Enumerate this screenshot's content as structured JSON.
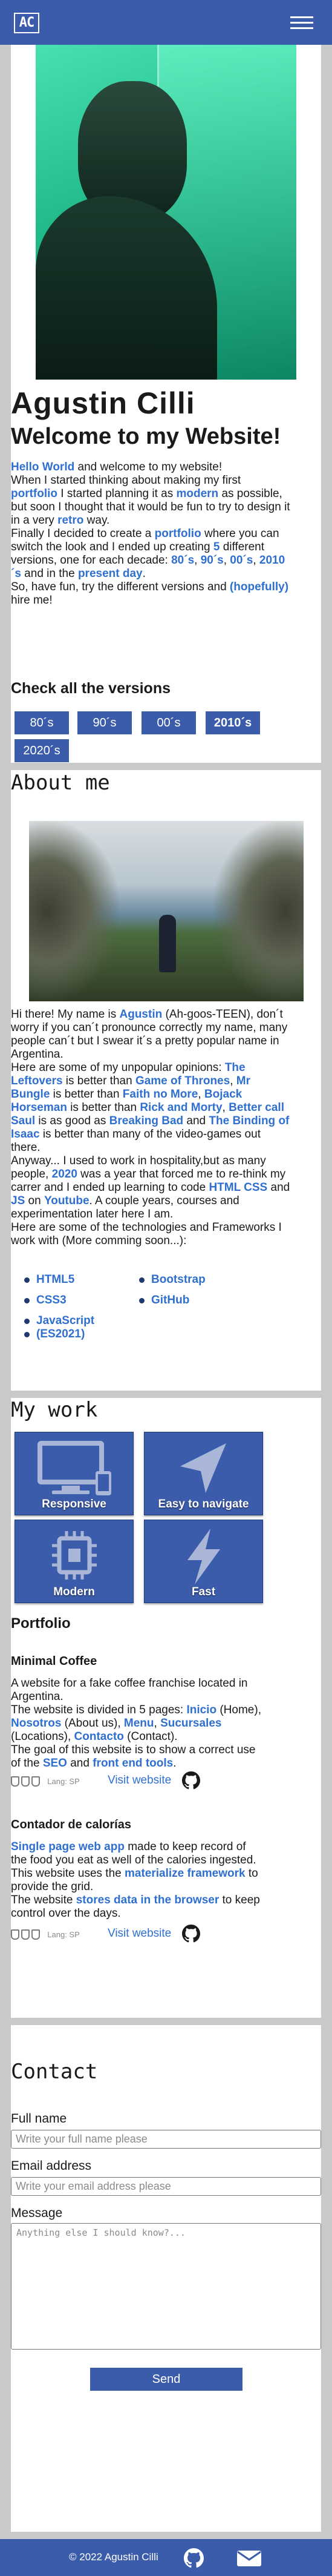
{
  "header": {
    "logo_text": "AC",
    "menu_icon": "hamburger-menu-icon"
  },
  "hero": {
    "name": "Agustin Cilli",
    "welcome": "Welcome to my Website!",
    "intro": [
      [
        {
          "t": "Hello World",
          "h": true
        },
        {
          "t": " and welcome to my website!"
        }
      ],
      [
        {
          "t": "When I started thinking about making my first "
        }
      ],
      [
        {
          "t": "portfolio",
          "h": true
        },
        {
          "t": " I started planning it as "
        },
        {
          "t": "modern",
          "h": true
        },
        {
          "t": " as possible,"
        }
      ],
      [
        {
          "t": "but soon I thought that it would be fun to try to design it"
        }
      ],
      [
        {
          "t": "in a very "
        },
        {
          "t": "retro",
          "h": true
        },
        {
          "t": " way."
        }
      ],
      [
        {
          "t": "Finally I decided to create a "
        },
        {
          "t": "portfolio",
          "h": true
        },
        {
          "t": " where you can"
        }
      ],
      [
        {
          "t": "switch the look and I ended up creating "
        },
        {
          "t": "5",
          "h": true
        },
        {
          "t": " different"
        }
      ],
      [
        {
          "t": "versions, one for each decade: "
        },
        {
          "t": "80´s",
          "h": true
        },
        {
          "t": ", "
        },
        {
          "t": "90´s",
          "h": true
        },
        {
          "t": ", "
        },
        {
          "t": "00´s",
          "h": true
        },
        {
          "t": ", "
        },
        {
          "t": "2010",
          "h": true
        }
      ],
      [
        {
          "t": "´s",
          "h": true
        },
        {
          "t": " and in the "
        },
        {
          "t": "present day",
          "h": true
        },
        {
          "t": "."
        }
      ],
      [
        {
          "t": "So, have fun, try the different versions and "
        },
        {
          "t": "(hopefully)",
          "h": true
        }
      ],
      [
        {
          "t": "hire me!"
        }
      ]
    ],
    "versions_title": "Check all the versions",
    "versions": [
      "80´s",
      "90´s",
      "00´s",
      "2010´s",
      "2020´s"
    ]
  },
  "about": {
    "title": "About me",
    "text": [
      [
        {
          "t": "Hi there! My name is "
        },
        {
          "t": "Agustin",
          "h": true
        },
        {
          "t": " (Ah-goos-TEEN), don´t"
        }
      ],
      [
        {
          "t": "worry if you can´t pronounce correctly my name, many"
        }
      ],
      [
        {
          "t": "people can´t but I swear it´s a pretty popular name in"
        }
      ],
      [
        {
          "t": "Argentina."
        }
      ],
      [
        {
          "t": "Here are some of my unpopular opinions: "
        },
        {
          "t": "The",
          "h": true
        }
      ],
      [
        {
          "t": "Leftovers",
          "h": true
        },
        {
          "t": " is better than "
        },
        {
          "t": "Game of Thrones",
          "h": true
        },
        {
          "t": ", "
        },
        {
          "t": "Mr",
          "h": true
        }
      ],
      [
        {
          "t": "Bungle",
          "h": true
        },
        {
          "t": " is better than "
        },
        {
          "t": "Faith no More",
          "h": true
        },
        {
          "t": ", "
        },
        {
          "t": "Bojack",
          "h": true
        }
      ],
      [
        {
          "t": "Horseman",
          "h": true
        },
        {
          "t": " is better than "
        },
        {
          "t": "Rick and Morty",
          "h": true
        },
        {
          "t": ", "
        },
        {
          "t": "Better call",
          "h": true
        }
      ],
      [
        {
          "t": "Saul",
          "h": true
        },
        {
          "t": " is as good as "
        },
        {
          "t": "Breaking Bad",
          "h": true
        },
        {
          "t": " and "
        },
        {
          "t": "The Binding of",
          "h": true
        }
      ],
      [
        {
          "t": "Isaac",
          "h": true
        },
        {
          "t": " is better than many of the video-games out"
        }
      ],
      [
        {
          "t": "there."
        }
      ],
      [
        {
          "t": "Anyway... I used to work in hospitality,but as many"
        }
      ],
      [
        {
          "t": "people, "
        },
        {
          "t": "2020",
          "h": true
        },
        {
          "t": " was a year that forced me to re-think my"
        }
      ],
      [
        {
          "t": "carrer and I ended up learning to code "
        },
        {
          "t": "HTML CSS",
          "h": true
        },
        {
          "t": " and"
        }
      ],
      [
        {
          "t": "JS",
          "h": true
        },
        {
          "t": " on "
        },
        {
          "t": "Youtube",
          "h": true
        },
        {
          "t": ". A couple years, courses and"
        }
      ],
      [
        {
          "t": "experimentation later here I am."
        }
      ],
      [
        {
          "t": "Here are some of the technologies and Frameworks I"
        }
      ],
      [
        {
          "t": "work with (More comming soon...):"
        }
      ]
    ],
    "tech_left": [
      "HTML5",
      "CSS3",
      "JavaScript",
      "(ES2021)"
    ],
    "tech_right": [
      "Bootstrap",
      "GitHub"
    ]
  },
  "work": {
    "title": "My work",
    "tiles": [
      {
        "label": "Responsive",
        "icon": "devices-icon"
      },
      {
        "label": "Easy to navigate",
        "icon": "navigation-arrow-icon"
      },
      {
        "label": "Modern",
        "icon": "chip-icon"
      },
      {
        "label": "Fast",
        "icon": "lightning-icon"
      }
    ],
    "portfolio_title": "Portfolio",
    "projects": [
      {
        "name": "Minimal Coffee",
        "desc": [
          [
            {
              "t": "A website for a fake coffee franchise located in"
            }
          ],
          [
            {
              "t": "Argentina."
            }
          ],
          [
            {
              "t": "The website is divided in 5 pages: "
            },
            {
              "t": "Inicio",
              "h": true
            },
            {
              "t": " (Home),"
            }
          ],
          [
            {
              "t": "Nosotros",
              "h": true
            },
            {
              "t": " (About us), "
            },
            {
              "t": "Menu",
              "h": true
            },
            {
              "t": ", "
            },
            {
              "t": "Sucursales",
              "h": true
            }
          ],
          [
            {
              "t": "(Locations), "
            },
            {
              "t": "Contacto",
              "h": true
            },
            {
              "t": " (Contact)."
            }
          ],
          [
            {
              "t": "The goal of this website is to show a correct use"
            }
          ],
          [
            {
              "t": "of the "
            },
            {
              "t": "SEO",
              "h": true
            },
            {
              "t": " and "
            },
            {
              "t": "front end tools",
              "h": true
            },
            {
              "t": "."
            }
          ]
        ],
        "lang": "Lang: SP",
        "visit": "Visit website"
      },
      {
        "name": "Contador de calorías",
        "desc": [
          [
            {
              "t": "Single page web app",
              "h": true
            },
            {
              "t": " made to keep record of"
            }
          ],
          [
            {
              "t": "the food you eat as well of the calories ingested."
            }
          ],
          [
            {
              "t": "This website uses the "
            },
            {
              "t": "materialize framework",
              "h": true
            },
            {
              "t": " to"
            }
          ],
          [
            {
              "t": "provide the grid."
            }
          ],
          [
            {
              "t": "The website "
            },
            {
              "t": "stores data in the browser",
              "h": true
            },
            {
              "t": " to keep"
            }
          ],
          [
            {
              "t": "control over the days."
            }
          ]
        ],
        "lang": "Lang: SP",
        "visit": "Visit website"
      }
    ]
  },
  "contact": {
    "title": "Contact",
    "fullname_label": "Full name",
    "fullname_placeholder": "Write your full name please",
    "email_label": "Email address",
    "email_placeholder": "Write your email address please",
    "message_label": "Message",
    "message_placeholder": "Anything else I should know?...",
    "send": "Send"
  },
  "footer": {
    "copyright": "© 2022 Agustin Cilli"
  }
}
